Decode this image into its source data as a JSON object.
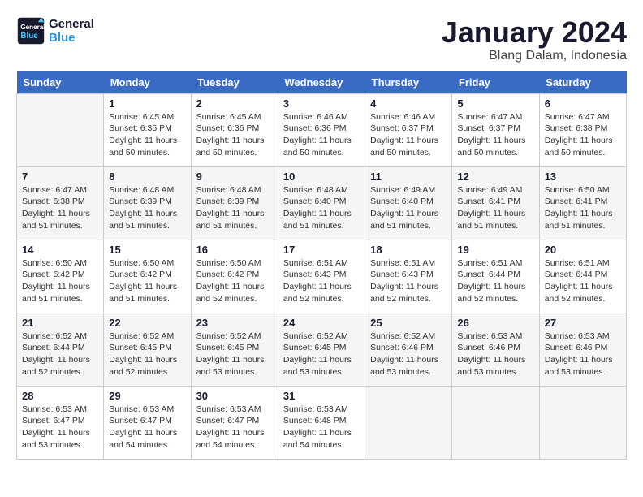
{
  "header": {
    "logo_line1": "General",
    "logo_line2": "Blue",
    "main_title": "January 2024",
    "subtitle": "Blang Dalam, Indonesia"
  },
  "weekdays": [
    "Sunday",
    "Monday",
    "Tuesday",
    "Wednesday",
    "Thursday",
    "Friday",
    "Saturday"
  ],
  "weeks": [
    [
      {
        "day": "",
        "sunrise": "",
        "sunset": "",
        "daylight": ""
      },
      {
        "day": "1",
        "sunrise": "Sunrise: 6:45 AM",
        "sunset": "Sunset: 6:35 PM",
        "daylight": "Daylight: 11 hours and 50 minutes."
      },
      {
        "day": "2",
        "sunrise": "Sunrise: 6:45 AM",
        "sunset": "Sunset: 6:36 PM",
        "daylight": "Daylight: 11 hours and 50 minutes."
      },
      {
        "day": "3",
        "sunrise": "Sunrise: 6:46 AM",
        "sunset": "Sunset: 6:36 PM",
        "daylight": "Daylight: 11 hours and 50 minutes."
      },
      {
        "day": "4",
        "sunrise": "Sunrise: 6:46 AM",
        "sunset": "Sunset: 6:37 PM",
        "daylight": "Daylight: 11 hours and 50 minutes."
      },
      {
        "day": "5",
        "sunrise": "Sunrise: 6:47 AM",
        "sunset": "Sunset: 6:37 PM",
        "daylight": "Daylight: 11 hours and 50 minutes."
      },
      {
        "day": "6",
        "sunrise": "Sunrise: 6:47 AM",
        "sunset": "Sunset: 6:38 PM",
        "daylight": "Daylight: 11 hours and 50 minutes."
      }
    ],
    [
      {
        "day": "7",
        "sunrise": "Sunrise: 6:47 AM",
        "sunset": "Sunset: 6:38 PM",
        "daylight": "Daylight: 11 hours and 51 minutes."
      },
      {
        "day": "8",
        "sunrise": "Sunrise: 6:48 AM",
        "sunset": "Sunset: 6:39 PM",
        "daylight": "Daylight: 11 hours and 51 minutes."
      },
      {
        "day": "9",
        "sunrise": "Sunrise: 6:48 AM",
        "sunset": "Sunset: 6:39 PM",
        "daylight": "Daylight: 11 hours and 51 minutes."
      },
      {
        "day": "10",
        "sunrise": "Sunrise: 6:48 AM",
        "sunset": "Sunset: 6:40 PM",
        "daylight": "Daylight: 11 hours and 51 minutes."
      },
      {
        "day": "11",
        "sunrise": "Sunrise: 6:49 AM",
        "sunset": "Sunset: 6:40 PM",
        "daylight": "Daylight: 11 hours and 51 minutes."
      },
      {
        "day": "12",
        "sunrise": "Sunrise: 6:49 AM",
        "sunset": "Sunset: 6:41 PM",
        "daylight": "Daylight: 11 hours and 51 minutes."
      },
      {
        "day": "13",
        "sunrise": "Sunrise: 6:50 AM",
        "sunset": "Sunset: 6:41 PM",
        "daylight": "Daylight: 11 hours and 51 minutes."
      }
    ],
    [
      {
        "day": "14",
        "sunrise": "Sunrise: 6:50 AM",
        "sunset": "Sunset: 6:42 PM",
        "daylight": "Daylight: 11 hours and 51 minutes."
      },
      {
        "day": "15",
        "sunrise": "Sunrise: 6:50 AM",
        "sunset": "Sunset: 6:42 PM",
        "daylight": "Daylight: 11 hours and 51 minutes."
      },
      {
        "day": "16",
        "sunrise": "Sunrise: 6:50 AM",
        "sunset": "Sunset: 6:42 PM",
        "daylight": "Daylight: 11 hours and 52 minutes."
      },
      {
        "day": "17",
        "sunrise": "Sunrise: 6:51 AM",
        "sunset": "Sunset: 6:43 PM",
        "daylight": "Daylight: 11 hours and 52 minutes."
      },
      {
        "day": "18",
        "sunrise": "Sunrise: 6:51 AM",
        "sunset": "Sunset: 6:43 PM",
        "daylight": "Daylight: 11 hours and 52 minutes."
      },
      {
        "day": "19",
        "sunrise": "Sunrise: 6:51 AM",
        "sunset": "Sunset: 6:44 PM",
        "daylight": "Daylight: 11 hours and 52 minutes."
      },
      {
        "day": "20",
        "sunrise": "Sunrise: 6:51 AM",
        "sunset": "Sunset: 6:44 PM",
        "daylight": "Daylight: 11 hours and 52 minutes."
      }
    ],
    [
      {
        "day": "21",
        "sunrise": "Sunrise: 6:52 AM",
        "sunset": "Sunset: 6:44 PM",
        "daylight": "Daylight: 11 hours and 52 minutes."
      },
      {
        "day": "22",
        "sunrise": "Sunrise: 6:52 AM",
        "sunset": "Sunset: 6:45 PM",
        "daylight": "Daylight: 11 hours and 52 minutes."
      },
      {
        "day": "23",
        "sunrise": "Sunrise: 6:52 AM",
        "sunset": "Sunset: 6:45 PM",
        "daylight": "Daylight: 11 hours and 53 minutes."
      },
      {
        "day": "24",
        "sunrise": "Sunrise: 6:52 AM",
        "sunset": "Sunset: 6:45 PM",
        "daylight": "Daylight: 11 hours and 53 minutes."
      },
      {
        "day": "25",
        "sunrise": "Sunrise: 6:52 AM",
        "sunset": "Sunset: 6:46 PM",
        "daylight": "Daylight: 11 hours and 53 minutes."
      },
      {
        "day": "26",
        "sunrise": "Sunrise: 6:53 AM",
        "sunset": "Sunset: 6:46 PM",
        "daylight": "Daylight: 11 hours and 53 minutes."
      },
      {
        "day": "27",
        "sunrise": "Sunrise: 6:53 AM",
        "sunset": "Sunset: 6:46 PM",
        "daylight": "Daylight: 11 hours and 53 minutes."
      }
    ],
    [
      {
        "day": "28",
        "sunrise": "Sunrise: 6:53 AM",
        "sunset": "Sunset: 6:47 PM",
        "daylight": "Daylight: 11 hours and 53 minutes."
      },
      {
        "day": "29",
        "sunrise": "Sunrise: 6:53 AM",
        "sunset": "Sunset: 6:47 PM",
        "daylight": "Daylight: 11 hours and 54 minutes."
      },
      {
        "day": "30",
        "sunrise": "Sunrise: 6:53 AM",
        "sunset": "Sunset: 6:47 PM",
        "daylight": "Daylight: 11 hours and 54 minutes."
      },
      {
        "day": "31",
        "sunrise": "Sunrise: 6:53 AM",
        "sunset": "Sunset: 6:48 PM",
        "daylight": "Daylight: 11 hours and 54 minutes."
      },
      {
        "day": "",
        "sunrise": "",
        "sunset": "",
        "daylight": ""
      },
      {
        "day": "",
        "sunrise": "",
        "sunset": "",
        "daylight": ""
      },
      {
        "day": "",
        "sunrise": "",
        "sunset": "",
        "daylight": ""
      }
    ]
  ]
}
